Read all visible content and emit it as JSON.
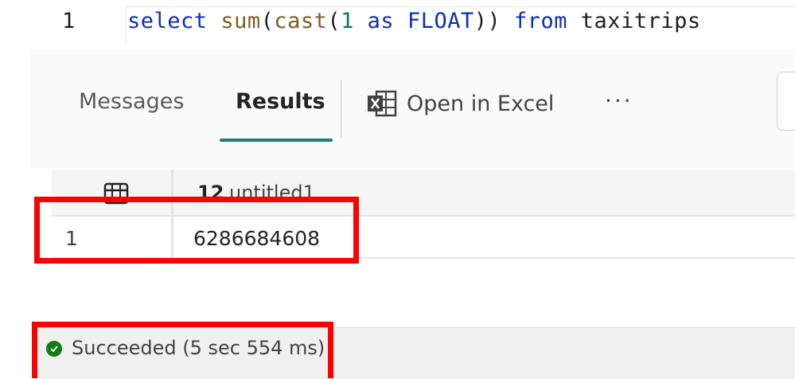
{
  "editor": {
    "line_number": "1",
    "code": {
      "kw_select": "select",
      "fn_sum": "sum",
      "p1": "(",
      "fn_cast": "cast",
      "p2": "(",
      "num": "1",
      "kw_as": " as ",
      "kw_float": "FLOAT",
      "p3": "))",
      "kw_from": " from ",
      "table": "taxitrips"
    }
  },
  "tabs": {
    "messages": "Messages",
    "results": "Results"
  },
  "toolbar": {
    "open_in_excel": "Open in Excel",
    "more": "···",
    "excel_icon": "excel-icon"
  },
  "grid": {
    "header_icon": "table-icon",
    "column_type": "12",
    "column_name": "untitled1",
    "rows": [
      {
        "row_number": "1",
        "value": "6286684608"
      }
    ]
  },
  "status": {
    "icon": "success-check-icon",
    "text": "Succeeded (5 sec 554 ms)"
  },
  "colors": {
    "accent": "#1a7f6e",
    "highlight": "#ff0000",
    "success": "#107c10"
  }
}
